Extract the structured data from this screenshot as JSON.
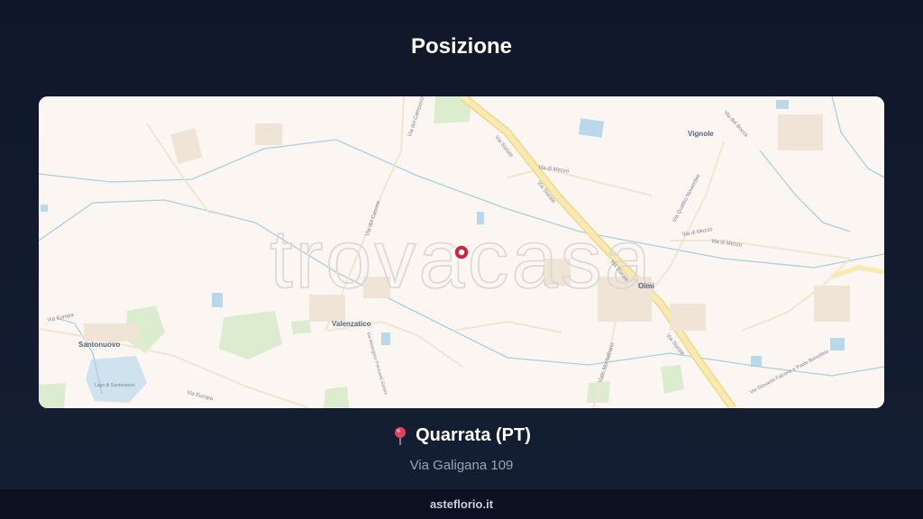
{
  "header": {
    "title": "Posizione"
  },
  "map": {
    "watermark": "trovacasa",
    "pin_icon": "map-target-icon",
    "places": {
      "vignole": "Vignole",
      "olmi": "Olmi",
      "valenzatico": "Valenzatico",
      "santonuovo": "Santonuovo"
    },
    "roads": {
      "via_statale_1": "Via Statale",
      "via_statale_2": "Via Statale",
      "via_statale_3": "Via Statale",
      "via_statale_4": "Via Statale",
      "via_di_mezzo_1": "Via di Mezzo",
      "via_di_mezzo_2": "Via di Mezzo",
      "via_di_mezzo_3": "Via di Mezzo",
      "via_europa_1": "Via Europa",
      "via_europa_2": "Via Europa",
      "via_quattro_novembre": "Via Quattro Novembre",
      "viale_montalbano": "Viale Montalbano",
      "via_del_casone": "Via del Casone",
      "via_del_campaccio": "Via del Campaccio",
      "via_giovanni_falcone": "Via Giovanni Falcone e Paolo Borsellino",
      "via_mamma_fioravanti": "Via Monsignor Fioravanti Santini",
      "via_bocca": "Via del Bocca",
      "lago_label": "Lago di Santonuovo"
    }
  },
  "location": {
    "pin_icon": "map-pin-icon",
    "city": "Quarrata (PT)",
    "address": "Via Galigana 109"
  },
  "footer": {
    "site": "asteflorio.it"
  },
  "colors": {
    "background": "#131b2e",
    "map_land": "#fbf6f2",
    "main_road": "#f5e7a8",
    "marker": "#d0243a"
  }
}
